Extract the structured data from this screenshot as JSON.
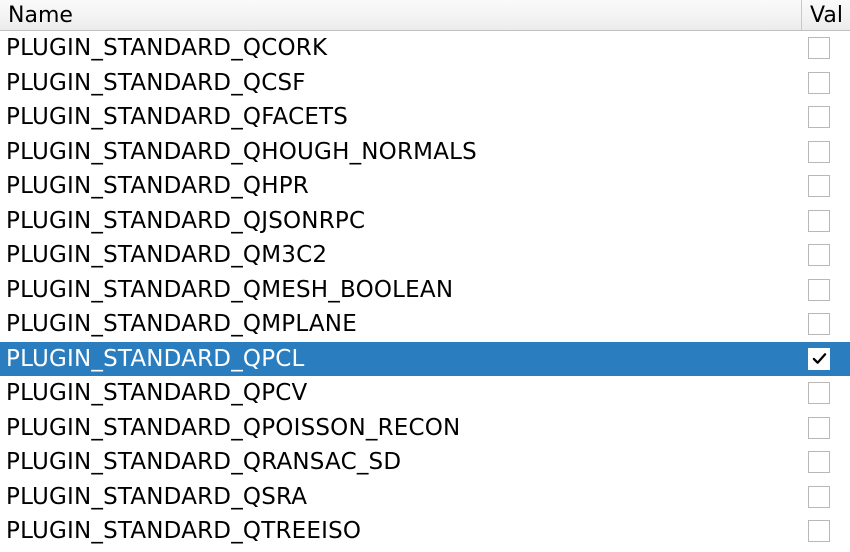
{
  "table": {
    "columns": {
      "name": "Name",
      "val": "Val"
    },
    "rows": [
      {
        "name": "PLUGIN_STANDARD_QCORK",
        "checked": false,
        "selected": false
      },
      {
        "name": "PLUGIN_STANDARD_QCSF",
        "checked": false,
        "selected": false
      },
      {
        "name": "PLUGIN_STANDARD_QFACETS",
        "checked": false,
        "selected": false
      },
      {
        "name": "PLUGIN_STANDARD_QHOUGH_NORMALS",
        "checked": false,
        "selected": false
      },
      {
        "name": "PLUGIN_STANDARD_QHPR",
        "checked": false,
        "selected": false
      },
      {
        "name": "PLUGIN_STANDARD_QJSONRPC",
        "checked": false,
        "selected": false
      },
      {
        "name": "PLUGIN_STANDARD_QM3C2",
        "checked": false,
        "selected": false
      },
      {
        "name": "PLUGIN_STANDARD_QMESH_BOOLEAN",
        "checked": false,
        "selected": false
      },
      {
        "name": "PLUGIN_STANDARD_QMPLANE",
        "checked": false,
        "selected": false
      },
      {
        "name": "PLUGIN_STANDARD_QPCL",
        "checked": true,
        "selected": true
      },
      {
        "name": "PLUGIN_STANDARD_QPCV",
        "checked": false,
        "selected": false
      },
      {
        "name": "PLUGIN_STANDARD_QPOISSON_RECON",
        "checked": false,
        "selected": false
      },
      {
        "name": "PLUGIN_STANDARD_QRANSAC_SD",
        "checked": false,
        "selected": false
      },
      {
        "name": "PLUGIN_STANDARD_QSRA",
        "checked": false,
        "selected": false
      },
      {
        "name": "PLUGIN_STANDARD_QTREEISO",
        "checked": false,
        "selected": false
      }
    ]
  }
}
